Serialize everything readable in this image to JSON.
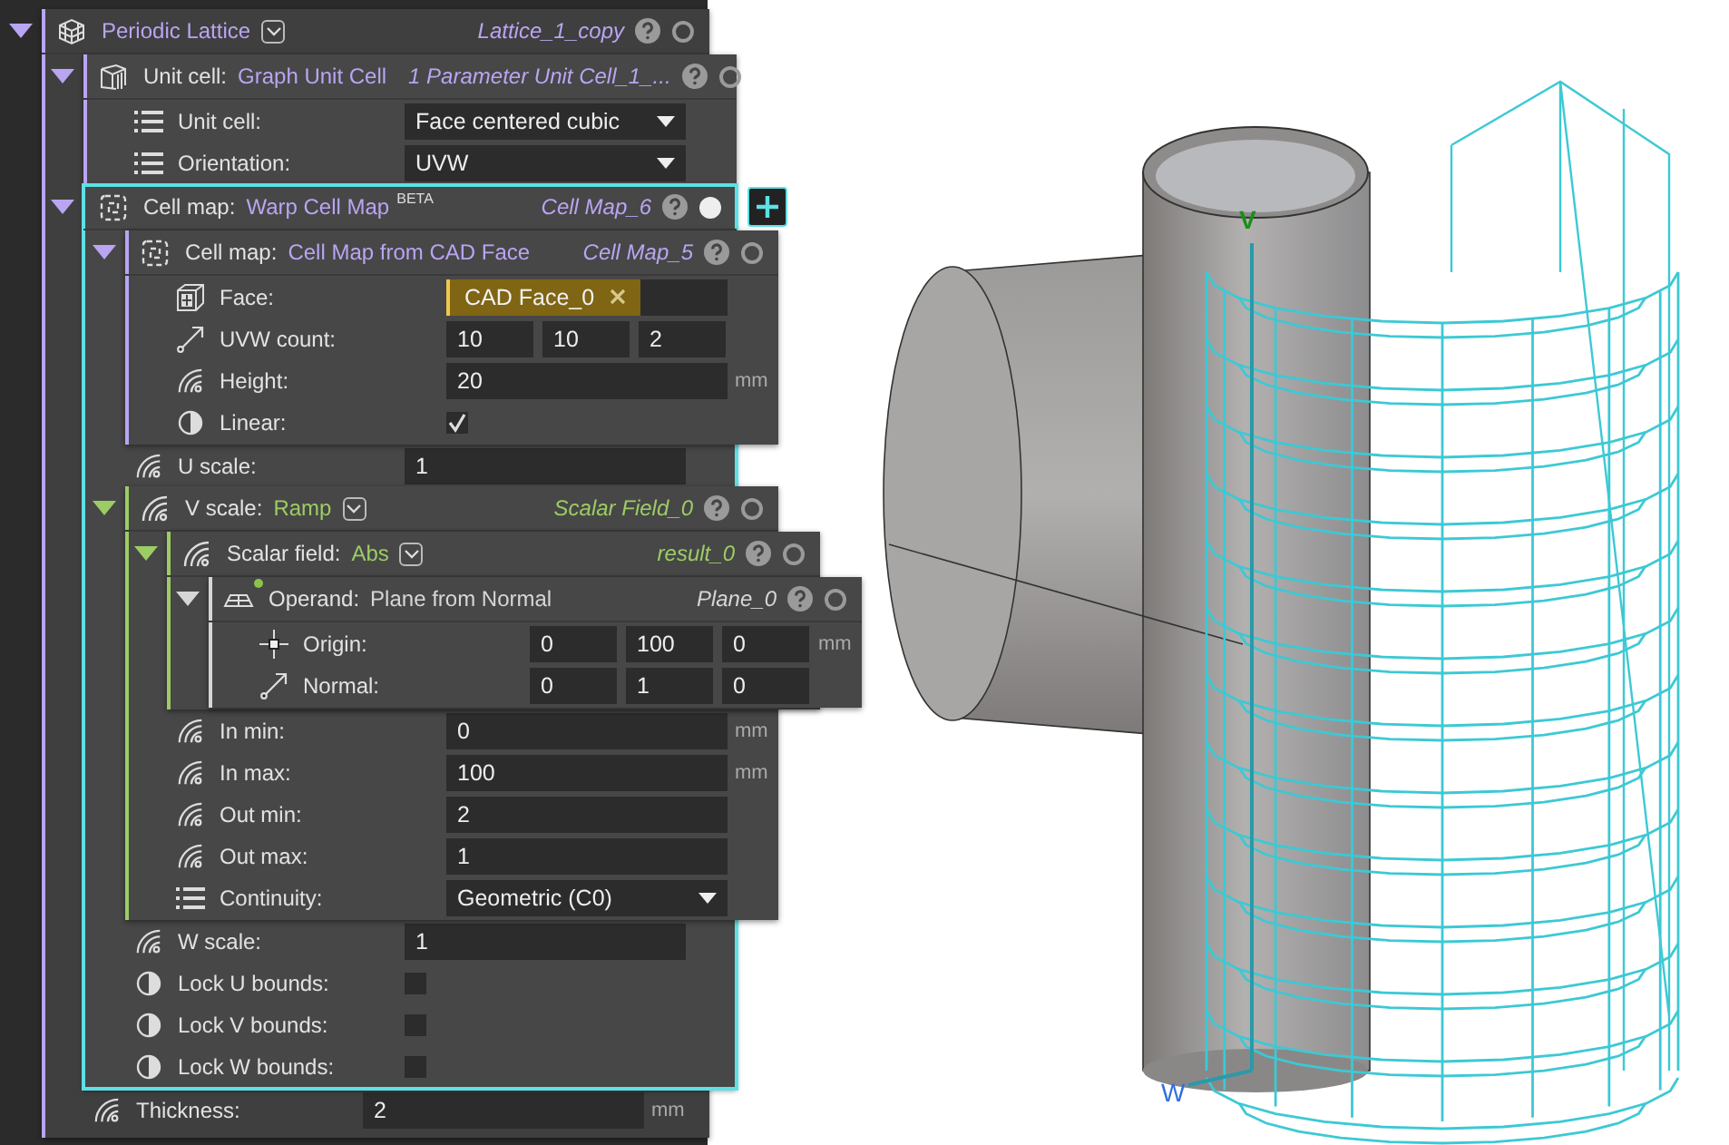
{
  "lattice": {
    "kind": "lattice",
    "expanded": true,
    "selected": false,
    "type_menu": true,
    "color": "#b9a5f2",
    "type": "Periodic Lattice",
    "name": "Lattice_1_copy",
    "children": [
      {
        "kind": "unit-cell",
        "expanded": true,
        "selected": false,
        "color": "#b9a5f2",
        "label": "Unit cell:",
        "type": "Graph Unit Cell",
        "name": "1 Parameter Unit Cell_1_...",
        "children": [
          {
            "kind": "dropdown",
            "label": "Unit cell:",
            "value": "Face centered cubic"
          },
          {
            "kind": "dropdown",
            "label": "Orientation:",
            "value": "UVW"
          }
        ]
      },
      {
        "kind": "cell-map",
        "expanded": true,
        "selected": true,
        "color": "#b9a5f2",
        "label": "Cell map:",
        "type": "Warp Cell Map",
        "badge": "BETA",
        "name": "Cell Map_6",
        "children": [
          {
            "kind": "cell-map",
            "expanded": true,
            "selected": false,
            "color": "#b9a5f2",
            "label": "Cell map:",
            "type": "Cell Map from CAD Face",
            "name": "Cell Map_5",
            "children": [
              {
                "kind": "face",
                "label": "Face:",
                "value": "CAD Face_0"
              },
              {
                "kind": "direction",
                "label": "UVW count:",
                "values": [
                  "10",
                  "10",
                  "2"
                ]
              },
              {
                "kind": "number",
                "label": "Height:",
                "value": "20",
                "unit": "mm"
              },
              {
                "kind": "checkbox",
                "label": "Linear:",
                "checked": true
              }
            ]
          },
          {
            "kind": "number",
            "label": "U scale:",
            "value": "1"
          },
          {
            "kind": "field",
            "expanded": true,
            "selected": false,
            "type_menu": true,
            "color": "#9ccc65",
            "label": "V scale:",
            "type": "Ramp",
            "name": "Scalar Field_0",
            "children": [
              {
                "kind": "field",
                "expanded": true,
                "selected": false,
                "type_menu": true,
                "color": "#9ccc65",
                "label": "Scalar field:",
                "type": "Abs",
                "name": "result_0",
                "children": [
                  {
                    "kind": "plane",
                    "expanded": true,
                    "selected": false,
                    "modified": true,
                    "color": "#d6d6d6",
                    "label": "Operand:",
                    "type": "Plane from Normal",
                    "name": "Plane_0",
                    "children": [
                      {
                        "kind": "point",
                        "label": "Origin:",
                        "values": [
                          "0",
                          "100",
                          "0"
                        ],
                        "unit": "mm"
                      },
                      {
                        "kind": "direction",
                        "label": "Normal:",
                        "values": [
                          "0",
                          "1",
                          "0"
                        ]
                      }
                    ]
                  }
                ]
              },
              {
                "kind": "number",
                "label": "In min:",
                "value": "0",
                "unit": "mm"
              },
              {
                "kind": "number",
                "label": "In max:",
                "value": "100",
                "unit": "mm"
              },
              {
                "kind": "number",
                "label": "Out min:",
                "value": "2"
              },
              {
                "kind": "number",
                "label": "Out max:",
                "value": "1"
              },
              {
                "kind": "dropdown",
                "label": "Continuity:",
                "value": "Geometric (C0)"
              }
            ]
          },
          {
            "kind": "number",
            "label": "W scale:",
            "value": "1"
          },
          {
            "kind": "checkbox",
            "label": "Lock U bounds:",
            "checked": false
          },
          {
            "kind": "checkbox",
            "label": "Lock V bounds:",
            "checked": false
          },
          {
            "kind": "checkbox",
            "label": "Lock W bounds:",
            "checked": false
          }
        ]
      },
      {
        "kind": "number",
        "label": "Thickness:",
        "value": "2",
        "unit": "mm"
      }
    ]
  },
  "viewport": {
    "axis_labels": [
      "V",
      "W"
    ]
  }
}
